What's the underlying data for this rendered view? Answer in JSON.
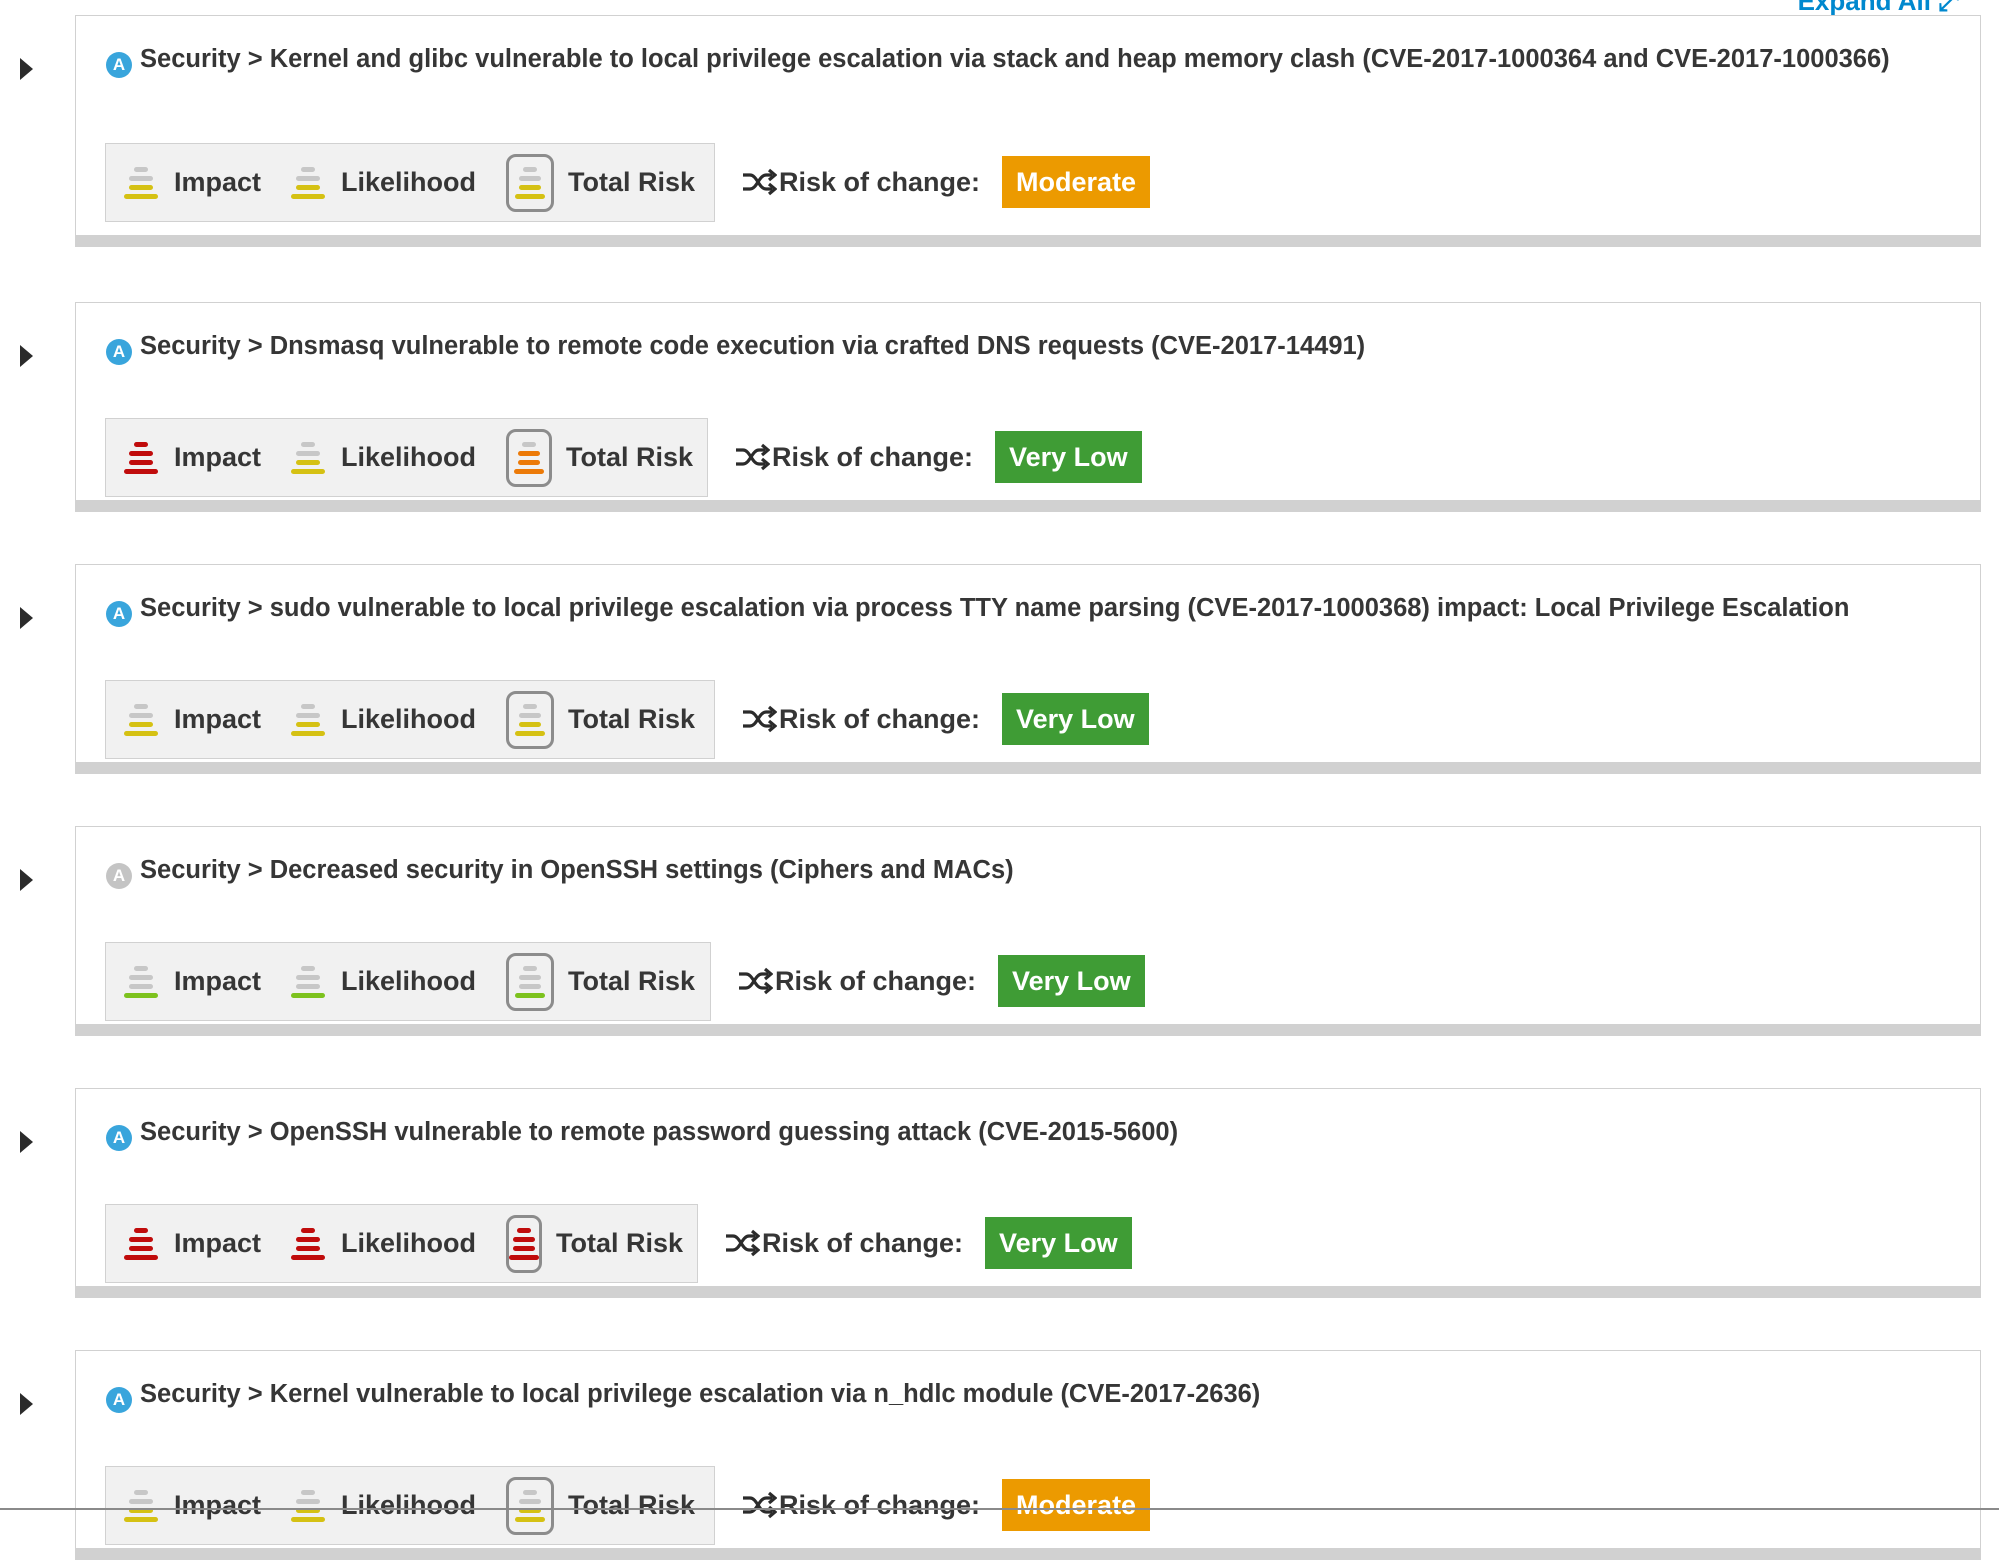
{
  "header": {
    "expand_all_label": "Expand All ⤢"
  },
  "colors": {
    "gray": "#c7c7c7",
    "yellow": "#d5c113",
    "green": "#7dc21e",
    "orange": "#ec7a08",
    "red": "#c00c0c",
    "moderate_badge": "#ec9a00",
    "very_low_badge": "#3f9c35",
    "ansible_on": "#39a5dc",
    "ansible_off": "#c4c4c4"
  },
  "labels": {
    "impact": "Impact",
    "likelihood": "Likelihood",
    "total_risk": "Total Risk",
    "risk_of_change": "Risk of change:",
    "ansible_glyph": "A"
  },
  "rules": [
    {
      "ansible": "on",
      "title": "Security > Kernel and glibc vulnerable to local privilege escalation via stack and heap memory clash (CVE-2017-1000364 and CVE-2017-1000366)",
      "impact": 2,
      "likelihood": 2,
      "total_risk": 2,
      "risk_of_change": "Moderate",
      "risk_of_change_level": "moderate"
    },
    {
      "ansible": "on",
      "title": "Security > Dnsmasq vulnerable to remote code execution via crafted DNS requests (CVE-2017-14491)",
      "impact": 4,
      "likelihood": 2,
      "total_risk": 3,
      "risk_of_change": "Very Low",
      "risk_of_change_level": "very_low"
    },
    {
      "ansible": "on",
      "title": "Security > sudo vulnerable to local privilege escalation via process TTY name parsing (CVE-2017-1000368) impact: Local Privilege Escalation",
      "impact": 2,
      "likelihood": 2,
      "total_risk": 2,
      "risk_of_change": "Very Low",
      "risk_of_change_level": "very_low"
    },
    {
      "ansible": "off",
      "title": "Security > Decreased security in OpenSSH settings (Ciphers and MACs)",
      "impact": 1,
      "likelihood": 1,
      "total_risk": 1,
      "risk_of_change": "Very Low",
      "risk_of_change_level": "very_low"
    },
    {
      "ansible": "on",
      "title": "Security > OpenSSH vulnerable to remote password guessing attack (CVE-2015-5600)",
      "impact": 4,
      "likelihood": 4,
      "total_risk": 4,
      "risk_of_change": "Very Low",
      "risk_of_change_level": "very_low"
    },
    {
      "ansible": "on",
      "title": "Security > Kernel vulnerable to local privilege escalation via n_hdlc module (CVE-2017-2636)",
      "impact": 2,
      "likelihood": 2,
      "total_risk": 2,
      "risk_of_change": "Moderate",
      "risk_of_change_level": "moderate"
    }
  ]
}
